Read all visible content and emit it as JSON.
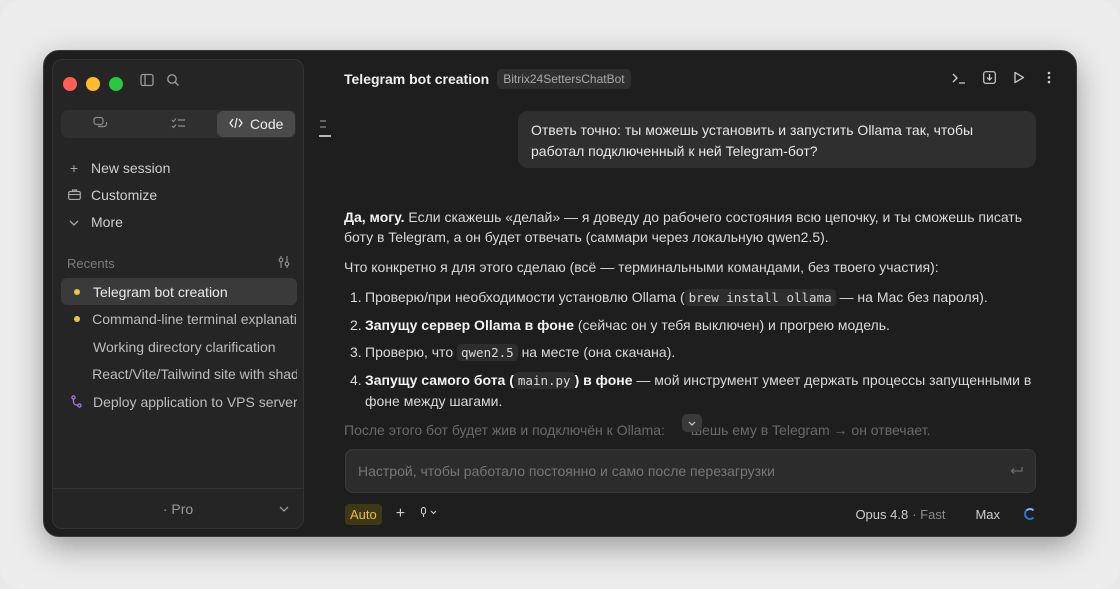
{
  "sidebar": {
    "segments": [
      {
        "label": "",
        "icon": "chat-bubbles-icon"
      },
      {
        "label": "",
        "icon": "checklist-icon"
      },
      {
        "label": "Code",
        "icon": "code-icon"
      }
    ],
    "menu": [
      {
        "label": "New session",
        "icon": "plus-icon"
      },
      {
        "label": "Customize",
        "icon": "briefcase-icon"
      },
      {
        "label": "More",
        "icon": "chevron-down-icon"
      }
    ],
    "recents_label": "Recents",
    "recents": [
      {
        "label": "Telegram bot creation",
        "marker": "dot"
      },
      {
        "label": "Command-line terminal explanation",
        "marker": "dot"
      },
      {
        "label": "Working directory clarification",
        "marker": "none"
      },
      {
        "label": "React/Vite/Tailwind site with shadcn",
        "marker": "none"
      },
      {
        "label": "Deploy application to VPS server",
        "marker": "branch"
      }
    ],
    "plan": "· Pro"
  },
  "header": {
    "title": "Telegram bot creation",
    "tag": "Bitrix24SettersChatBot"
  },
  "chat": {
    "user_message": "Ответь точно: ты можешь установить и запустить Ollama так, чтобы работал подключенный к ней Telegram-бот?",
    "intro_bold": "Да, могу.",
    "intro_rest": " Если скажешь «делай» — я доведу до рабочего состояния всю цепочку, и ты сможешь писать боту в Telegram, а он будет отвечать (саммари через локальную qwen2.5).",
    "lead": "Что конкретно я для этого сделаю (всё — терминальными командами, без твоего участия):",
    "steps": [
      {
        "n": "1.",
        "a": "Проверю/при необходимости установлю Ollama (",
        "code": "brew install ollama",
        "b": " — на Mac без пароля)."
      },
      {
        "n": "2.",
        "bold": "Запущу сервер Ollama в фоне",
        "rest": " (сейчас он у тебя выключен) и прогрею модель."
      },
      {
        "n": "3.",
        "a": "Проверю, что ",
        "code": "qwen2.5",
        "b": " на месте (она скачана)."
      },
      {
        "n": "4.",
        "bold1": "Запущу самого бота (",
        "code": "main.py",
        "bold2": ") в фоне",
        "rest": " — мой инструмент умеет держать процессы запущенными в фоне между шагами."
      }
    ],
    "faded_line_a": "После этого бот будет жив и подключён к Ollama: ",
    "faded_line_b": "шешь ему в Telegram → он отвечает."
  },
  "composer": {
    "placeholder": "Настрой, чтобы работало постоянно и само после перезагрузки",
    "mode": "Auto",
    "model": "Opus 4.8",
    "speed": "· Fast",
    "effort": "Max"
  },
  "colors": {
    "accent_yellow": "#e9c13c",
    "window_bg": "#1e1e1e",
    "spinner_blue": "#2f6fd6"
  }
}
